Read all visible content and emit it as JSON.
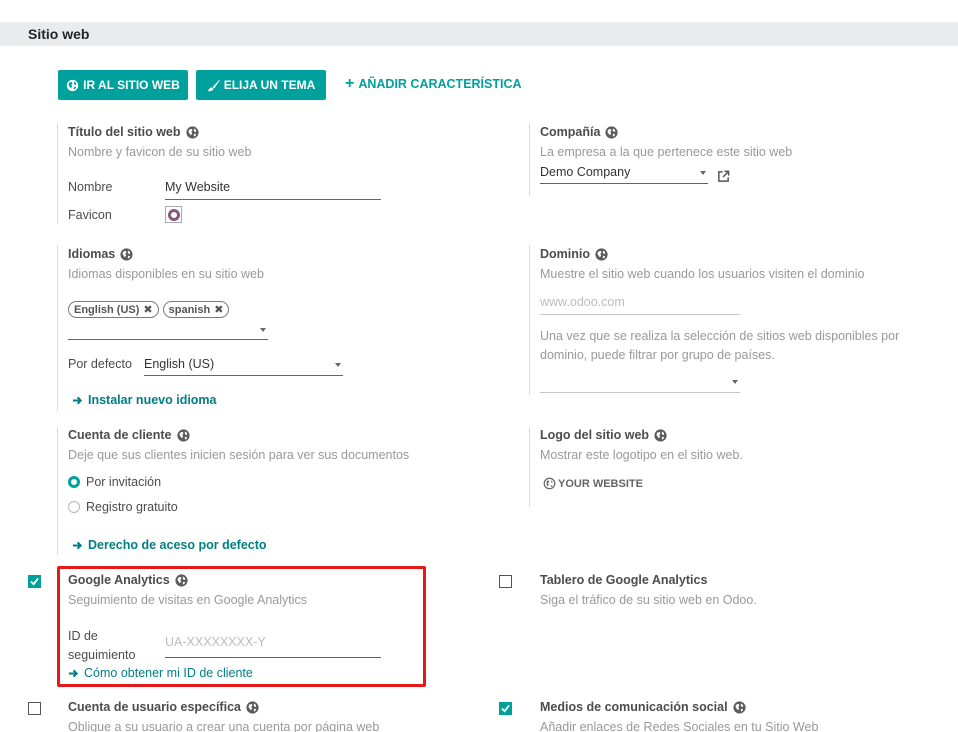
{
  "section": {
    "title": "Sitio web"
  },
  "toolbar": {
    "go_site": "IR AL SITIO WEB",
    "choose_theme": "ELIJA UN TEMA",
    "add_feature": "AÑADIR CARACTERÍSTICA"
  },
  "site_title": {
    "title": "Título del sitio web",
    "desc": "Nombre y favicon de su sitio web",
    "name_label": "Nombre",
    "name_value": "My Website",
    "favicon_label": "Favicon"
  },
  "company": {
    "title": "Compañía",
    "desc": "La empresa a la que pertenece este sitio web",
    "value": "Demo Company"
  },
  "languages": {
    "title": "Idiomas",
    "desc": "Idiomas disponibles en su sitio web",
    "tags": [
      "English (US)",
      "spanish"
    ],
    "default_label": "Por defecto",
    "default_value": "English (US)",
    "install_link": "Instalar nuevo idioma"
  },
  "domain": {
    "title": "Dominio",
    "desc": "Muestre el sitio web cuando los usuarios visiten el dominio",
    "placeholder": "www.odoo.com",
    "note_line1": "Una vez que se realiza la selección de sitios web disponibles por",
    "note_line2": "dominio, puede filtrar por grupo de países."
  },
  "customer_account": {
    "title": "Cuenta de cliente",
    "desc": "Deje que sus clientes inicien sesión para ver sus documentos",
    "option_invite": "Por invitación",
    "option_free": "Registro gratuito",
    "selected": "Por invitación",
    "default_rights_link": "Derecho de aceso por defecto"
  },
  "logo": {
    "title": "Logo del sitio web",
    "desc": "Mostrar este logotipo en el sitio web.",
    "logo_text": "YOUR WEBSITE"
  },
  "google_analytics": {
    "title": "Google Analytics",
    "desc": "Seguimiento de visitas en Google Analytics",
    "checked": true,
    "tracking_label_line1": "ID de",
    "tracking_label_line2": "seguimiento",
    "tracking_placeholder": "UA-XXXXXXXX-Y",
    "help_link": "Cómo obtener mi ID de cliente"
  },
  "ga_dashboard": {
    "title": "Tablero de Google Analytics",
    "desc": "Siga el tráfico de su sitio web en Odoo.",
    "checked": false
  },
  "specific_user": {
    "title": "Cuenta de usuario específica",
    "desc": "Obligue a su usuario a crear una cuenta por página web",
    "checked": false
  },
  "social_media": {
    "title": "Medios de comunicación social",
    "desc": "Añadir enlaces de Redes Sociales en tu Sitio Web",
    "checked": true
  },
  "colors": {
    "accent": "#00a09d",
    "link": "#017e84",
    "highlight": "#e21a1a"
  }
}
